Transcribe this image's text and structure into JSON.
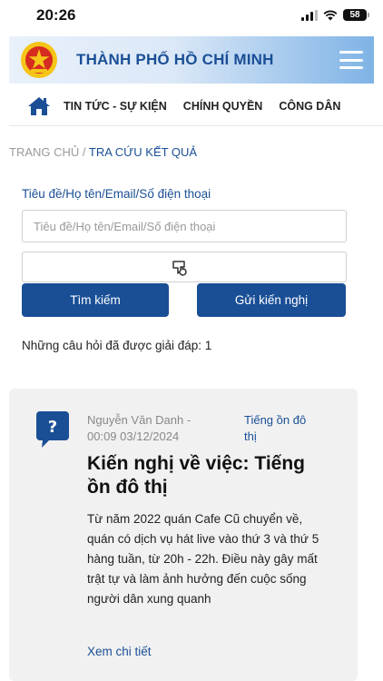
{
  "status_bar": {
    "time": "20:26",
    "battery": "58"
  },
  "header": {
    "title": "THÀNH PHỐ HỒ CHÍ MINH"
  },
  "nav": {
    "items": [
      {
        "label": "TIN TỨC - SỰ KIỆN"
      },
      {
        "label": "CHÍNH QUYỀN"
      },
      {
        "label": "CÔNG DÂN"
      }
    ]
  },
  "breadcrumb": {
    "home": "TRANG CHỦ",
    "separator": " / ",
    "current": "TRA CỨU KẾT QUẢ"
  },
  "search": {
    "label": "Tiêu đề/Họ tên/Email/Số điện thoại",
    "placeholder": "Tiêu đề/Họ tên/Email/Số điện thoại",
    "value": ""
  },
  "buttons": {
    "search": "Tìm kiếm",
    "submit": "Gửi kiến nghị"
  },
  "results": {
    "answered_text": "Những câu hỏi đã được giải đáp: 1"
  },
  "card": {
    "author": "Nguyễn Văn Danh -",
    "datetime": "00:09 03/12/2024",
    "topic": "Tiếng ồn đô thị",
    "title": "Kiến nghị về việc: Tiếng ồn đô thị",
    "body": "Từ năm 2022 quán Cafe Cũ chuyển về, quán có dịch vụ hát live vào thứ 3 và thứ 5 hàng tuần, từ 20h - 22h. Điều này gây mất trật tự và làm ảnh hưởng đến cuộc sống người dân xung quanh",
    "detail_link": "Xem chi tiết"
  },
  "colors": {
    "primary": "#1a4f96",
    "emblem_red": "#d62b1f",
    "emblem_gold": "#f5c518"
  },
  "icons": {
    "menu": "hamburger-icon",
    "home": "home-icon",
    "captcha": "refresh-captcha-icon",
    "question": "question-icon"
  }
}
